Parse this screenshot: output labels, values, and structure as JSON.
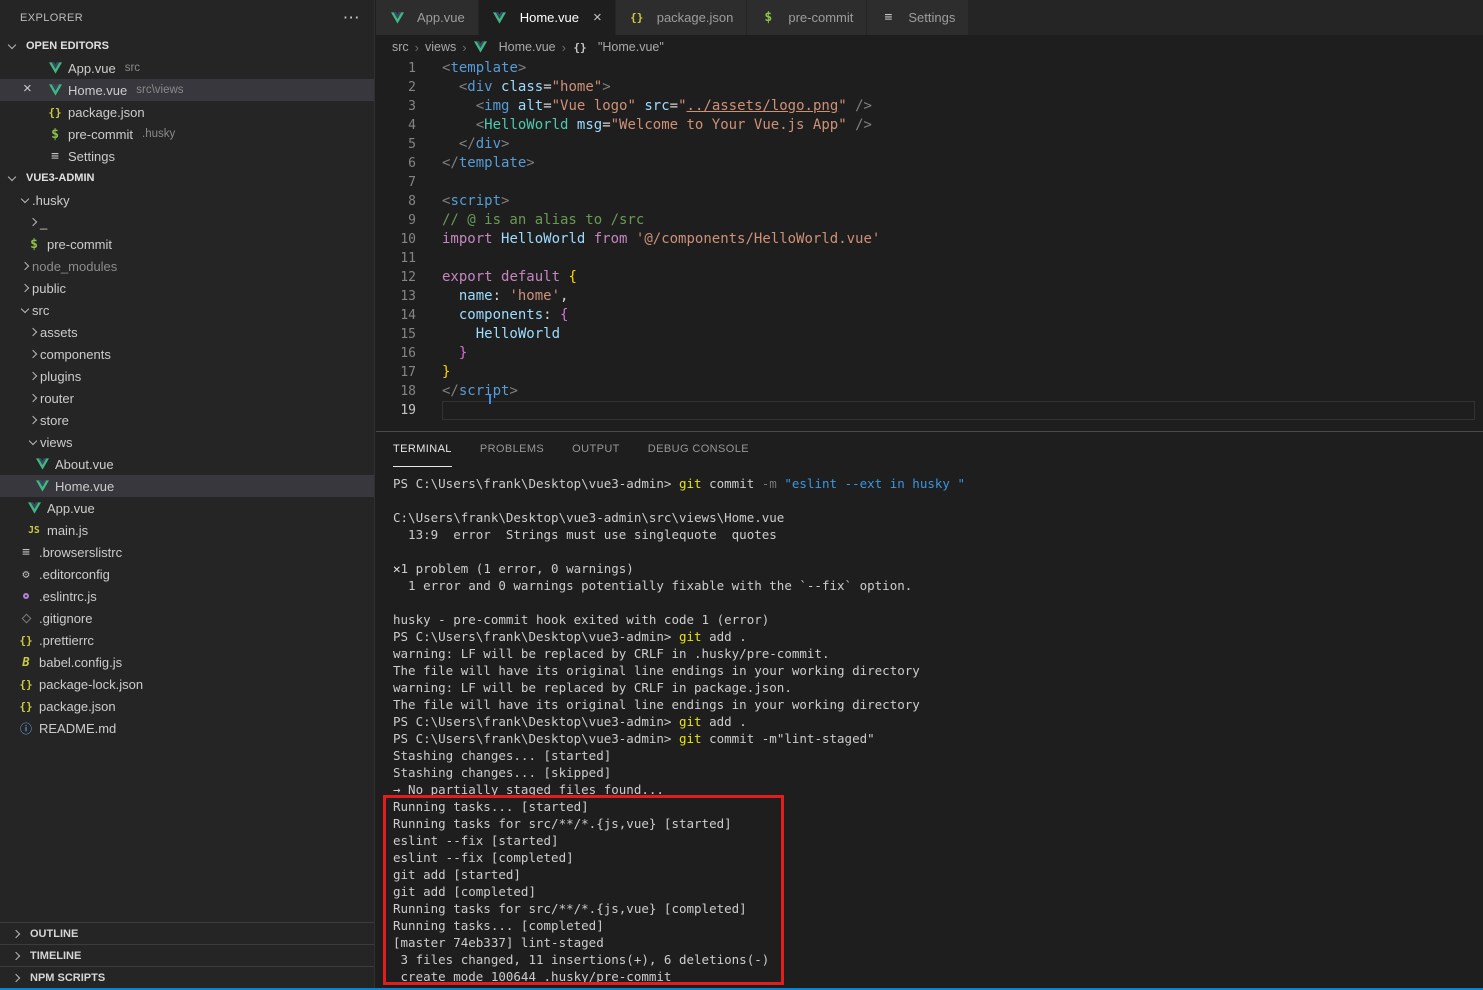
{
  "colors": {
    "accent_blue": "#0a84d0",
    "annotation_red": "#e11d1d",
    "vue_green": "#41b883",
    "selection": "#37373d",
    "terminal_command_yellow": "#e5e510",
    "terminal_string_cyan": "#3a96dd"
  },
  "sidebar": {
    "title": "EXPLORER",
    "more_icon": "⋯",
    "open_editors": {
      "label": "OPEN EDITORS",
      "items": [
        {
          "icon": "vue",
          "label": "App.vue",
          "desc": "src"
        },
        {
          "icon": "vue",
          "label": "Home.vue",
          "desc": "src\\views",
          "selected": true,
          "close": "×"
        },
        {
          "icon": "json",
          "label": "package.json"
        },
        {
          "icon": "shell",
          "label": "pre-commit",
          "desc": ".husky"
        },
        {
          "icon": "settings",
          "label": "Settings"
        }
      ]
    },
    "project": {
      "label": "VUE3-ADMIN",
      "items": [
        {
          "indent": 1,
          "chevron": "down",
          "label": ".husky"
        },
        {
          "indent": 2,
          "chevron": "right",
          "label": "_"
        },
        {
          "indent": 2,
          "icon": "shell",
          "label": "pre-commit"
        },
        {
          "indent": 1,
          "chevron": "right",
          "label": "node_modules",
          "dim": true
        },
        {
          "indent": 1,
          "chevron": "right",
          "label": "public"
        },
        {
          "indent": 1,
          "chevron": "down",
          "label": "src"
        },
        {
          "indent": 2,
          "chevron": "right",
          "label": "assets"
        },
        {
          "indent": 2,
          "chevron": "right",
          "label": "components"
        },
        {
          "indent": 2,
          "chevron": "right",
          "label": "plugins"
        },
        {
          "indent": 2,
          "chevron": "right",
          "label": "router"
        },
        {
          "indent": 2,
          "chevron": "right",
          "label": "store"
        },
        {
          "indent": 2,
          "chevron": "down",
          "label": "views"
        },
        {
          "indent": 3,
          "icon": "vue",
          "label": "About.vue"
        },
        {
          "indent": 3,
          "icon": "vue",
          "label": "Home.vue",
          "selected": true
        },
        {
          "indent": 2,
          "icon": "vue",
          "label": "App.vue"
        },
        {
          "indent": 2,
          "icon": "js",
          "label": "main.js"
        },
        {
          "indent": 1,
          "icon": "list",
          "label": ".browserslistrc"
        },
        {
          "indent": 1,
          "icon": "gear",
          "label": ".editorconfig"
        },
        {
          "indent": 1,
          "icon": "eslint",
          "label": ".eslintrc.js"
        },
        {
          "indent": 1,
          "icon": "git",
          "label": ".gitignore"
        },
        {
          "indent": 1,
          "icon": "json",
          "label": ".prettierrc"
        },
        {
          "indent": 1,
          "icon": "babel",
          "label": "babel.config.js"
        },
        {
          "indent": 1,
          "icon": "json",
          "label": "package-lock.json"
        },
        {
          "indent": 1,
          "icon": "json",
          "label": "package.json"
        },
        {
          "indent": 1,
          "icon": "info",
          "label": "README.md"
        }
      ]
    },
    "bottom_sections": [
      {
        "label": "OUTLINE"
      },
      {
        "label": "TIMELINE"
      },
      {
        "label": "NPM SCRIPTS"
      }
    ]
  },
  "tabs": [
    {
      "icon": "vue",
      "label": "App.vue"
    },
    {
      "icon": "vue",
      "label": "Home.vue",
      "active": true,
      "close": "×"
    },
    {
      "icon": "json",
      "label": "package.json"
    },
    {
      "icon": "shell",
      "label": "pre-commit"
    },
    {
      "icon": "settings",
      "label": "Settings"
    }
  ],
  "breadcrumb": {
    "separator": "›",
    "items": [
      {
        "label": "src"
      },
      {
        "label": "views"
      },
      {
        "icon": "vue",
        "label": "Home.vue"
      },
      {
        "icon": "json-sym",
        "label": "\"Home.vue\""
      }
    ]
  },
  "editor": {
    "lines": [
      {
        "n": "1",
        "tokens": [
          [
            "<",
            "pn"
          ],
          [
            "template",
            "tag"
          ],
          [
            ">",
            "pn"
          ]
        ]
      },
      {
        "n": "2",
        "tokens": [
          [
            "  ",
            "d"
          ],
          [
            "<",
            "pn"
          ],
          [
            "div",
            "tag"
          ],
          [
            " ",
            "d"
          ],
          [
            "class",
            "attr"
          ],
          [
            "=",
            "d"
          ],
          [
            "\"home\"",
            "str"
          ],
          [
            ">",
            "pn"
          ]
        ]
      },
      {
        "n": "3",
        "tokens": [
          [
            "    ",
            "d"
          ],
          [
            "<",
            "pn"
          ],
          [
            "img",
            "tag"
          ],
          [
            " ",
            "d"
          ],
          [
            "alt",
            "attr"
          ],
          [
            "=",
            "d"
          ],
          [
            "\"Vue logo\"",
            "str"
          ],
          [
            " ",
            "d"
          ],
          [
            "src",
            "attr"
          ],
          [
            "=",
            "d"
          ],
          [
            "\"",
            "str"
          ],
          [
            "../assets/logo.png",
            "strU"
          ],
          [
            "\"",
            "str"
          ],
          [
            " ",
            "d"
          ],
          [
            "/>",
            "pn"
          ]
        ]
      },
      {
        "n": "4",
        "tokens": [
          [
            "    ",
            "d"
          ],
          [
            "<",
            "pn"
          ],
          [
            "HelloWorld",
            "comp"
          ],
          [
            " ",
            "d"
          ],
          [
            "msg",
            "attr"
          ],
          [
            "=",
            "d"
          ],
          [
            "\"Welcome to Your Vue.js App\"",
            "str"
          ],
          [
            " ",
            "d"
          ],
          [
            "/>",
            "pn"
          ]
        ]
      },
      {
        "n": "5",
        "tokens": [
          [
            "  ",
            "d"
          ],
          [
            "</",
            "pn"
          ],
          [
            "div",
            "tag"
          ],
          [
            ">",
            "pn"
          ]
        ]
      },
      {
        "n": "6",
        "tokens": [
          [
            "</",
            "pn"
          ],
          [
            "template",
            "tag"
          ],
          [
            ">",
            "pn"
          ]
        ]
      },
      {
        "n": "7",
        "tokens": []
      },
      {
        "n": "8",
        "tokens": [
          [
            "<",
            "pn"
          ],
          [
            "script",
            "tag"
          ],
          [
            ">",
            "pn"
          ]
        ]
      },
      {
        "n": "9",
        "tokens": [
          [
            "// @ is an alias to /src",
            "cmt"
          ]
        ]
      },
      {
        "n": "10",
        "tokens": [
          [
            "import",
            "kw"
          ],
          [
            " ",
            "d"
          ],
          [
            "HelloWorld",
            "var"
          ],
          [
            " ",
            "d"
          ],
          [
            "from",
            "kw"
          ],
          [
            " ",
            "d"
          ],
          [
            "'@/components/HelloWorld.vue'",
            "str"
          ]
        ]
      },
      {
        "n": "11",
        "tokens": []
      },
      {
        "n": "12",
        "tokens": [
          [
            "export",
            "kw"
          ],
          [
            " ",
            "d"
          ],
          [
            "default",
            "kw"
          ],
          [
            " ",
            "d"
          ],
          [
            "{",
            "b1"
          ]
        ]
      },
      {
        "n": "13",
        "tokens": [
          [
            "  ",
            "d"
          ],
          [
            "name",
            "attr"
          ],
          [
            ": ",
            "d"
          ],
          [
            "'home'",
            "str"
          ],
          [
            ",",
            "d"
          ]
        ]
      },
      {
        "n": "14",
        "tokens": [
          [
            "  ",
            "d"
          ],
          [
            "components",
            "attr"
          ],
          [
            ": ",
            "d"
          ],
          [
            "{",
            "b2"
          ]
        ]
      },
      {
        "n": "15",
        "tokens": [
          [
            "    ",
            "d"
          ],
          [
            "HelloWorld",
            "var"
          ]
        ]
      },
      {
        "n": "16",
        "tokens": [
          [
            "  ",
            "d"
          ],
          [
            "}",
            "b2"
          ]
        ]
      },
      {
        "n": "17",
        "tokens": [
          [
            "}",
            "b1"
          ]
        ]
      },
      {
        "n": "18",
        "tokens": [
          [
            "</",
            "pn"
          ],
          [
            "script",
            "tag"
          ],
          [
            ">",
            "pn"
          ]
        ]
      },
      {
        "n": "19",
        "tokens": [],
        "active": true,
        "curline": true
      }
    ]
  },
  "panel": {
    "tabs": [
      {
        "label": "TERMINAL",
        "active": true
      },
      {
        "label": "PROBLEMS"
      },
      {
        "label": "OUTPUT"
      },
      {
        "label": "DEBUG CONSOLE"
      }
    ],
    "terminal_lines": [
      {
        "segs": [
          [
            "PS C:\\Users\\frank\\Desktop\\vue3-admin> ",
            "d"
          ],
          [
            "git",
            "y"
          ],
          [
            " commit ",
            "d"
          ],
          [
            "-m ",
            "dim"
          ],
          [
            "\"eslint --ext in husky \"",
            "cyan"
          ]
        ]
      },
      {
        "segs": []
      },
      {
        "segs": [
          [
            "C:\\Users\\frank\\Desktop\\vue3-admin\\src\\views\\Home.vue",
            "d"
          ]
        ]
      },
      {
        "segs": [
          [
            "  13:9  error  Strings must use singlequote  quotes",
            "d"
          ]
        ]
      },
      {
        "segs": []
      },
      {
        "segs": [
          [
            "✕",
            "xb"
          ],
          [
            "1 problem (1 error, 0 warnings)",
            "d"
          ]
        ]
      },
      {
        "segs": [
          [
            "  1 error and 0 warnings potentially fixable with the `--fix` option.",
            "d"
          ]
        ]
      },
      {
        "segs": []
      },
      {
        "segs": [
          [
            "husky - pre-commit hook exited with code 1 (error)",
            "d"
          ]
        ]
      },
      {
        "segs": [
          [
            "PS C:\\Users\\frank\\Desktop\\vue3-admin> ",
            "d"
          ],
          [
            "git",
            "y"
          ],
          [
            " add .",
            "d"
          ]
        ]
      },
      {
        "segs": [
          [
            "warning: LF will be replaced by CRLF in .husky/pre-commit.",
            "d"
          ]
        ]
      },
      {
        "segs": [
          [
            "The file will have its original line endings in your working directory",
            "d"
          ]
        ]
      },
      {
        "segs": [
          [
            "warning: LF will be replaced by CRLF in package.json.",
            "d"
          ]
        ]
      },
      {
        "segs": [
          [
            "The file will have its original line endings in your working directory",
            "d"
          ]
        ]
      },
      {
        "segs": [
          [
            "PS C:\\Users\\frank\\Desktop\\vue3-admin> ",
            "d"
          ],
          [
            "git",
            "y"
          ],
          [
            " add .",
            "d"
          ]
        ]
      },
      {
        "segs": [
          [
            "PS C:\\Users\\frank\\Desktop\\vue3-admin> ",
            "d"
          ],
          [
            "git",
            "y"
          ],
          [
            " commit -m\"lint-staged\"",
            "d"
          ]
        ]
      },
      {
        "segs": [
          [
            "Stashing changes... [started]",
            "d"
          ]
        ]
      },
      {
        "segs": [
          [
            "Stashing changes... [skipped]",
            "d"
          ]
        ]
      },
      {
        "segs": [
          [
            "→ No partially staged files found...",
            "d"
          ]
        ]
      },
      {
        "segs": [
          [
            "Running tasks... [started]",
            "d"
          ]
        ]
      },
      {
        "segs": [
          [
            "Running tasks for src/**/*.{js,vue} [started]",
            "d"
          ]
        ]
      },
      {
        "segs": [
          [
            "eslint --fix [started]",
            "d"
          ]
        ]
      },
      {
        "segs": [
          [
            "eslint --fix [completed]",
            "d"
          ]
        ]
      },
      {
        "segs": [
          [
            "git add [started]",
            "d"
          ]
        ]
      },
      {
        "segs": [
          [
            "git add [completed]",
            "d"
          ]
        ]
      },
      {
        "segs": [
          [
            "Running tasks for src/**/*.{js,vue} [completed]",
            "d"
          ]
        ]
      },
      {
        "segs": [
          [
            "Running tasks... [completed]",
            "d"
          ]
        ]
      },
      {
        "segs": [
          [
            "[master 74eb337] lint-staged",
            "d"
          ]
        ]
      },
      {
        "segs": [
          [
            " 3 files changed, 11 insertions(+), 6 deletions(-)",
            "d"
          ]
        ]
      },
      {
        "segs": [
          [
            " create mode 100644 .husky/pre-commit",
            "d"
          ]
        ]
      }
    ]
  }
}
